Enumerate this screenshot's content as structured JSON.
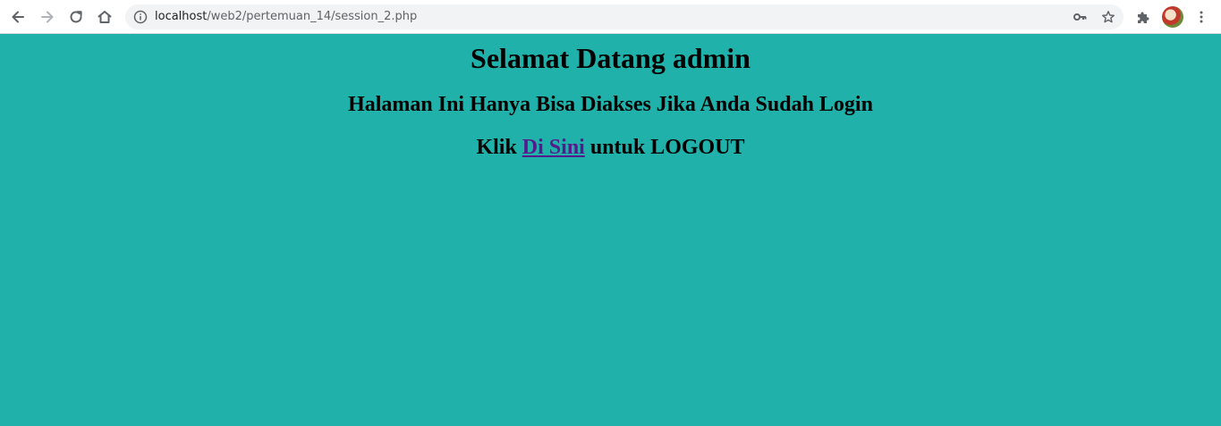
{
  "browser": {
    "url_host": "localhost",
    "url_path": "/web2/pertemuan_14/session_2.php",
    "icons": {
      "back": "back-arrow-icon",
      "forward": "forward-arrow-icon",
      "reload": "reload-icon",
      "home": "home-icon",
      "site_info": "info-icon",
      "password": "key-icon",
      "bookmark": "star-icon",
      "extensions": "puzzle-icon",
      "menu": "kebab-menu-icon"
    }
  },
  "page": {
    "background_color": "#20b2aa",
    "heading": "Selamat Datang admin",
    "subheading": "Halaman Ini Hanya Bisa Diakses Jika Anda Sudah Login",
    "logout_prefix": "Klik ",
    "logout_link_text": "Di Sini",
    "logout_suffix": " untuk LOGOUT",
    "link_color": "#551a8b"
  }
}
